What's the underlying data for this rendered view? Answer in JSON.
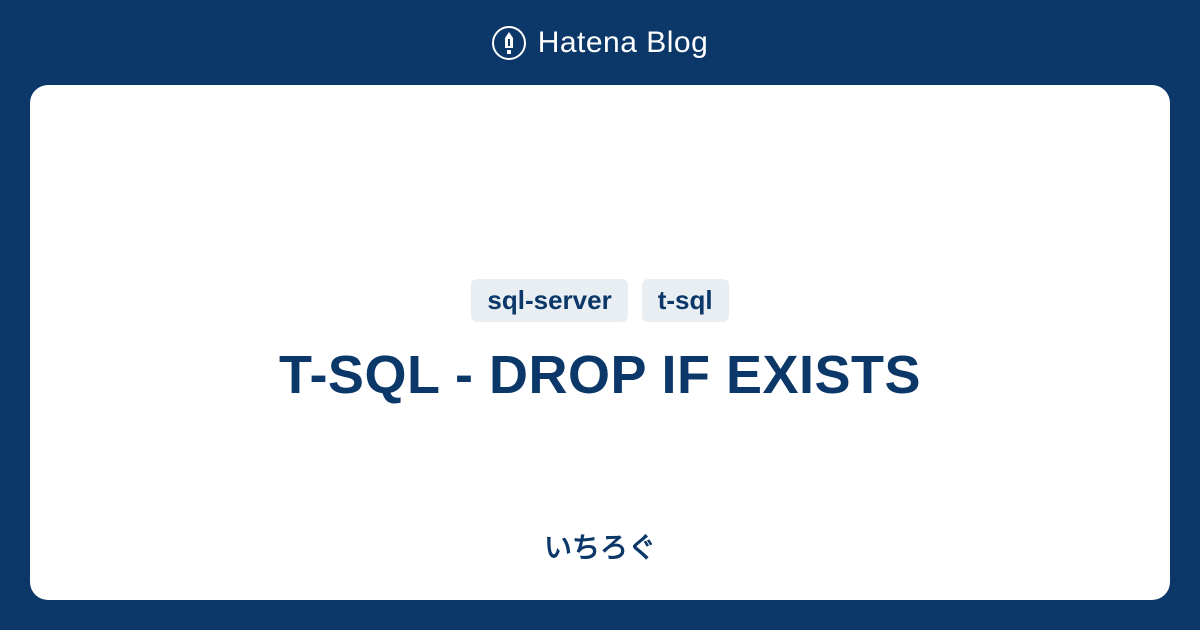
{
  "header": {
    "brand": "Hatena Blog"
  },
  "card": {
    "tags": [
      "sql-server",
      "t-sql"
    ],
    "title": "T-SQL - DROP IF EXISTS",
    "author": "いちろぐ"
  },
  "colors": {
    "background": "#0b3869",
    "card": "#ffffff",
    "text": "#0b3869",
    "tagBg": "#e9eef3"
  }
}
